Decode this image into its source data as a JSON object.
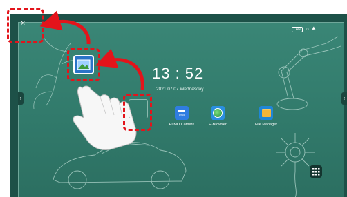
{
  "status_bar": {
    "net_label": "LAN",
    "icons": [
      "network-icon",
      "wifi-icon",
      "bluetooth-icon"
    ]
  },
  "clock": {
    "time": "13 : 52",
    "date": "2021.07.07  Wednesday"
  },
  "apps": [
    {
      "label": "ELMO Camera",
      "icon": "camera-usb-icon",
      "color": "#2f7de1"
    },
    {
      "label": "E-Browser",
      "icon": "browser-icon",
      "color": "#2a8fe0"
    },
    {
      "label": "File Manager",
      "icon": "folder-icon",
      "color": "#1f86d6"
    }
  ],
  "usb_badge": "USB",
  "close_glyph": "×",
  "edge_tabs": {
    "left": "›",
    "right": "‹"
  },
  "annotation": {
    "highlight_color": "#e3141b"
  }
}
